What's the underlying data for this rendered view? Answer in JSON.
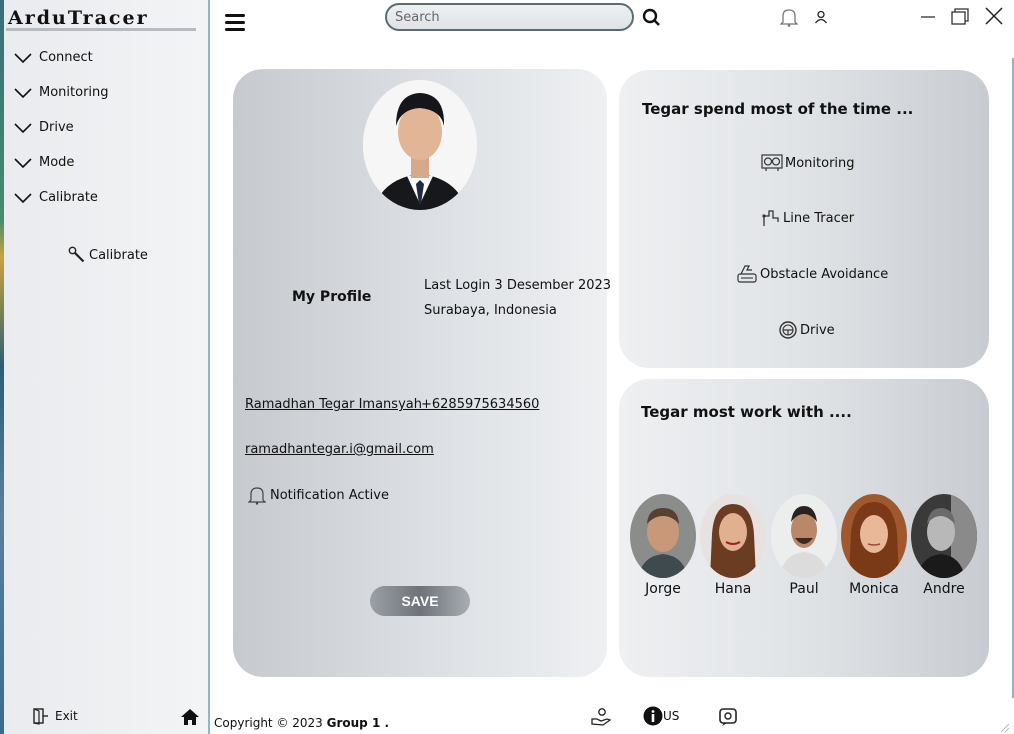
{
  "app": {
    "title": "ArduTracer"
  },
  "sidebar": {
    "menu": [
      {
        "label": "Connect"
      },
      {
        "label": "Monitoring"
      },
      {
        "label": "Drive"
      },
      {
        "label": "Mode"
      },
      {
        "label": "Calibrate"
      }
    ],
    "calibrate_button": "Calibrate",
    "exit_label": "Exit"
  },
  "topbar": {
    "search_placeholder": "Search",
    "icons": [
      "menu-icon",
      "search-icon",
      "bell-icon",
      "user-icon",
      "minimize-icon",
      "maximize-icon",
      "close-icon"
    ]
  },
  "profile": {
    "heading": "My Profile",
    "last_login": "Last Login 3 Desember 2023",
    "location": "Surabaya, Indonesia",
    "name": "Ramadhan Tegar Imansyah",
    "phone": "+6285975634560",
    "email": "ramadhantegar.i@gmail.com",
    "notification": "Notification Active",
    "save_label": "SAVE"
  },
  "spend": {
    "title": "Tegar spend most of the time ...",
    "activities": [
      {
        "label": "Monitoring",
        "icon": "monitoring-icon"
      },
      {
        "label": "Line Tracer",
        "icon": "line-tracer-icon"
      },
      {
        "label": "Obstacle Avoidance",
        "icon": "obstacle-icon"
      },
      {
        "label": "Drive",
        "icon": "steering-wheel-icon"
      }
    ]
  },
  "work": {
    "title": "Tegar most work with ....",
    "mates": [
      {
        "name": "Jorge"
      },
      {
        "name": "Hana"
      },
      {
        "name": "Paul"
      },
      {
        "name": "Monica"
      },
      {
        "name": "Andre"
      }
    ]
  },
  "footer": {
    "copyright_prefix": "Copyright © 2023 ",
    "copyright_group": "Group 1 .",
    "info_label": "US"
  },
  "colors": {
    "accent_border": "#8fb6c9",
    "card_gray": "#c6cacf",
    "save_gray": "#6d7379"
  }
}
